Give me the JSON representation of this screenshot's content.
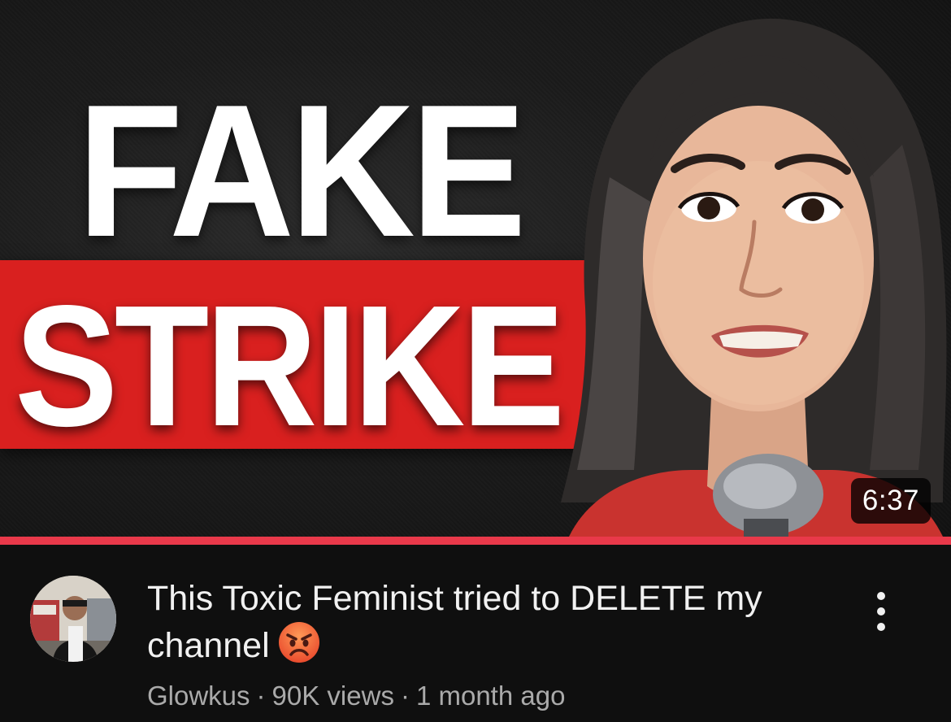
{
  "video": {
    "thumbnail": {
      "headline_top": "FAKE",
      "headline_bottom": "STRIKE",
      "duration": "6:37",
      "watched_fraction": 1.0,
      "colors": {
        "band": "#d9201f",
        "progress": "#e9394a"
      }
    },
    "title": "This Toxic Feminist tried to DELETE my channel",
    "title_emoji": "angry-face-emoji",
    "channel": "Glowkus",
    "views": "90K views",
    "age": "1 month ago",
    "separator": "·",
    "more_icon": "vertical-ellipsis-icon"
  }
}
